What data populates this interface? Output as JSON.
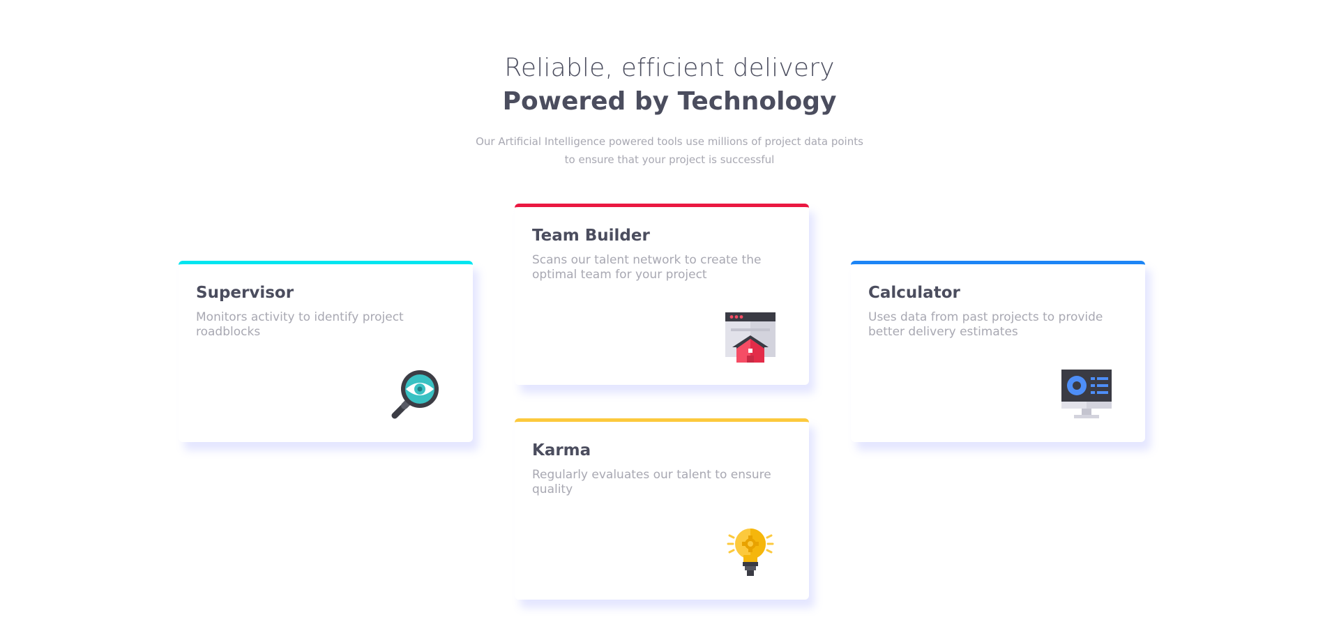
{
  "header": {
    "headline_light": "Reliable, efficient delivery",
    "headline_bold": "Powered by Technology",
    "subtitle": "Our Artificial Intelligence powered tools use millions of project data points to ensure that your project is successful"
  },
  "cards": [
    {
      "title": "Supervisor",
      "description": "Monitors activity to identify project roadblocks",
      "accent": "#00e5f0",
      "icon": "magnifier-eye-icon"
    },
    {
      "title": "Team Builder",
      "description": "Scans our talent network to create the optimal team for your project",
      "accent": "#ea1841",
      "icon": "browser-house-icon"
    },
    {
      "title": "Karma",
      "description": "Regularly evaluates our talent to ensure quality",
      "accent": "#fcc93d",
      "icon": "lightbulb-icon"
    },
    {
      "title": "Calculator",
      "description": "Uses data from past projects to provide better delivery estimates",
      "accent": "#1d85f5",
      "icon": "monitor-dashboard-icon"
    }
  ]
}
